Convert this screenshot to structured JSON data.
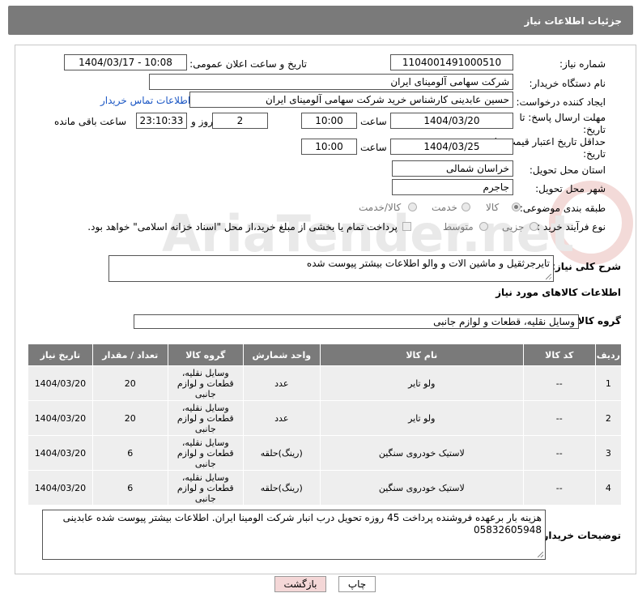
{
  "page_title": "جزئیات اطلاعات نیاز",
  "fields": {
    "need_number_label": "شماره نیاز:",
    "need_number": "1104001491000510",
    "announce_label": "تاریخ و ساعت اعلان عمومی:",
    "announce_value": "1404/03/17 - 10:08",
    "buyer_org_label": "نام دستگاه خریدار:",
    "buyer_org": "شرکت سهامی آلومینای ایران",
    "creator_label": "ایجاد کننده درخواست:",
    "creator": "حسین عابدینی کارشناس خرید شرکت سهامی آلومینای ایران",
    "contact_link": "اطلاعات تماس خریدار",
    "reply_deadline_label": "مهلت ارسال پاسخ: تا تاریخ:",
    "reply_date": "1404/03/20",
    "time_label": "ساعت",
    "reply_time": "10:00",
    "days": "2",
    "days_label": "روز و",
    "remaining_time": "23:10:33",
    "remaining_label": "ساعت باقی مانده",
    "price_validity_label": "حداقل تاریخ اعتبار قیمت: تا تاریخ:",
    "price_date": "1404/03/25",
    "price_time": "10:00",
    "province_label": "استان محل تحویل:",
    "province": "خراسان شمالی",
    "city_label": "شهر محل تحویل:",
    "city": "جاجرم",
    "category_label": "طبقه بندی موضوعی:",
    "category_options": [
      "کالا",
      "خدمت",
      "کالا/خدمت"
    ],
    "process_label": "نوع فرآیند خرید :",
    "process_options": [
      "جزیی",
      "متوسط"
    ],
    "payment_note": "پرداخت تمام یا بخشی از مبلغ خرید،از محل \"اسناد خزانه اسلامی\" خواهد بود.",
    "description_label": "شرح کلی نیاز:",
    "description": "تایرجرثقیل و ماشین الات و والو اطلاعات بیشتر پیوست شده",
    "goods_info_title": "اطلاعات کالاهای مورد نیاز",
    "goods_group_label": "گروه کالا:",
    "goods_group": "وسایل نقلیه، قطعات و لوازم جانبی",
    "buyer_notes_label": "توضیحات خریدار:",
    "buyer_notes": "هزینه بار برعهده فروشنده پرداخت 45 روزه تحویل درب انبار شرکت الومینا ایران. اطلاعات بیشتر پیوست شده عابدینی 05832605948"
  },
  "table": {
    "headers": [
      "ردیف",
      "کد کالا",
      "نام کالا",
      "واحد شمارش",
      "گروه کالا",
      "تعداد / مقدار",
      "تاریخ نیاز"
    ],
    "rows": [
      [
        "1",
        "--",
        "ولو تایر",
        "عدد",
        "وسایل نقلیه، قطعات و لوازم جانبی",
        "20",
        "1404/03/20"
      ],
      [
        "2",
        "--",
        "ولو تایر",
        "عدد",
        "وسایل نقلیه، قطعات و لوازم جانبی",
        "20",
        "1404/03/20"
      ],
      [
        "3",
        "--",
        "لاستیک خودروی سنگین",
        "(رینگ)حلقه",
        "وسایل نقلیه، قطعات و لوازم جانبی",
        "6",
        "1404/03/20"
      ],
      [
        "4",
        "--",
        "لاستیک خودروی سنگین",
        "(رینگ)حلقه",
        "وسایل نقلیه، قطعات و لوازم جانبی",
        "6",
        "1404/03/20"
      ]
    ]
  },
  "buttons": {
    "print": "چاپ",
    "back": "بازگشت"
  },
  "watermark_text": "AriaTender.net",
  "colors": {
    "header_bg": "#7a7a7a",
    "link": "#1a56c4",
    "back_btn": "#f4d7d7"
  }
}
